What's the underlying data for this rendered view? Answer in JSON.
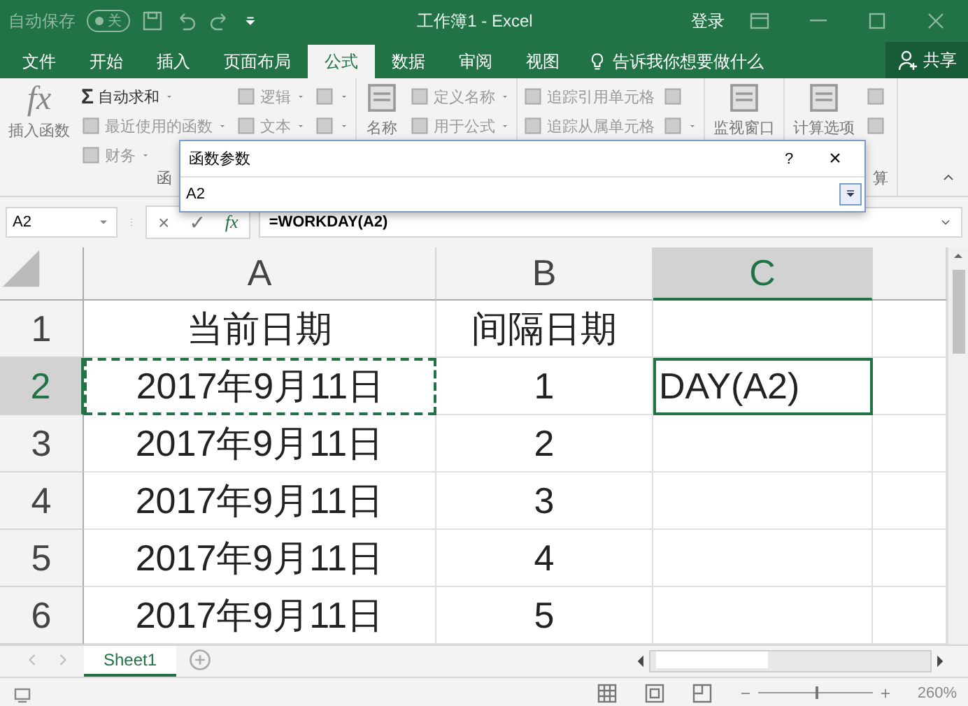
{
  "title_bar": {
    "autosave_label": "自动保存",
    "autosave_toggle": "关",
    "autosave_on": false,
    "title": "工作簿1  -  Excel",
    "sign_in": "登录"
  },
  "tabs": [
    {
      "label": "文件",
      "selected": false
    },
    {
      "label": "开始",
      "selected": false
    },
    {
      "label": "插入",
      "selected": false
    },
    {
      "label": "页面布局",
      "selected": false
    },
    {
      "label": "公式",
      "selected": true
    },
    {
      "label": "数据",
      "selected": false
    },
    {
      "label": "审阅",
      "selected": false
    },
    {
      "label": "视图",
      "selected": false
    }
  ],
  "tell_me": "告诉我你想要做什么",
  "share": "共享",
  "ribbon": {
    "groups": [
      {
        "label": "函",
        "big": {
          "glyph": "fx",
          "label": "插入函数"
        },
        "columns": [
          [
            {
              "glyph": "Σ",
              "label": "自动求和",
              "dropdown": true,
              "disabled": false
            },
            {
              "label": "最近使用的函数",
              "dropdown": true,
              "disabled": true
            },
            {
              "label": "财务",
              "dropdown": true,
              "disabled": true
            }
          ],
          [
            {
              "label": "逻辑",
              "dropdown": true,
              "disabled": true
            },
            {
              "label": "文本",
              "dropdown": true,
              "disabled": true
            }
          ],
          [
            {
              "dropdown": true,
              "disabled": true
            },
            {
              "dropdown": true,
              "disabled": true
            }
          ]
        ]
      },
      {
        "big": {
          "label": "名称"
        },
        "columns": [
          [
            {
              "label": "定义名称",
              "dropdown": true,
              "disabled": true
            },
            {
              "label": "用于公式",
              "dropdown": true,
              "disabled": true
            }
          ]
        ]
      },
      {
        "columns": [
          [
            {
              "label": "追踪引用单元格",
              "dropdown": false,
              "disabled": true
            },
            {
              "label": "追踪从属单元格",
              "dropdown": false,
              "disabled": true
            }
          ],
          [
            {
              "dropdown": false,
              "disabled": true
            },
            {
              "dropdown": true,
              "disabled": true
            }
          ]
        ]
      },
      {
        "big": {
          "label": "监视窗口"
        }
      },
      {
        "label": "算",
        "big": {
          "label": "计算选项"
        },
        "columns": [
          [
            {
              "dropdown": false,
              "disabled": true
            },
            {
              "dropdown": false,
              "disabled": true
            }
          ]
        ]
      }
    ]
  },
  "dialog": {
    "title": "函数参数",
    "help": "?",
    "close": "×",
    "value": "A2"
  },
  "formula_bar": {
    "name_box": "A2",
    "cancel": "×",
    "enter": "✓",
    "function": "fx",
    "formula": "=WORKDAY(A2)"
  },
  "columns": [
    {
      "label": "A",
      "selected": false
    },
    {
      "label": "B",
      "selected": false
    },
    {
      "label": "C",
      "selected": true
    },
    {}
  ],
  "rows": [
    {
      "header": "1",
      "selected": false,
      "cells": [
        {
          "text": "当前日期"
        },
        {
          "text": "间隔日期"
        },
        {},
        {}
      ]
    },
    {
      "header": "2",
      "selected": true,
      "cells": [
        {
          "text": "2017年9月11日",
          "copy_marquee": true
        },
        {
          "text": "1"
        },
        {
          "text": "DAY(A2)",
          "editing": true
        },
        {}
      ]
    },
    {
      "header": "3",
      "selected": false,
      "cells": [
        {
          "text": "2017年9月11日"
        },
        {
          "text": "2"
        },
        {},
        {}
      ]
    },
    {
      "header": "4",
      "selected": false,
      "cells": [
        {
          "text": "2017年9月11日"
        },
        {
          "text": "3"
        },
        {},
        {}
      ]
    },
    {
      "header": "5",
      "selected": false,
      "cells": [
        {
          "text": "2017年9月11日"
        },
        {
          "text": "4"
        },
        {},
        {}
      ]
    },
    {
      "header": "6",
      "selected": false,
      "cells": [
        {
          "text": "2017年9月11日"
        },
        {
          "text": "5"
        },
        {},
        {}
      ]
    }
  ],
  "sheets": [
    {
      "label": "Sheet1",
      "selected": true
    }
  ],
  "status_bar": {
    "zoom": "260%",
    "zoom_slider": {
      "level": 0.5
    }
  }
}
